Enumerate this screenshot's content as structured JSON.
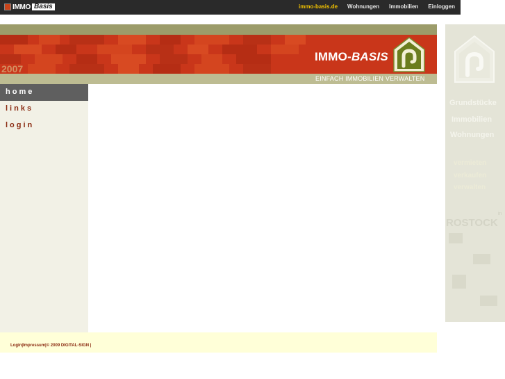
{
  "topbar": {
    "logo_text1": "IMMO",
    "logo_text2": "Basis",
    "nav": [
      {
        "label": "immo-basis.de",
        "active": true
      },
      {
        "label": "Wohnungen",
        "active": false
      },
      {
        "label": "Immobilien",
        "active": false
      },
      {
        "label": "Einloggen",
        "active": false
      }
    ]
  },
  "banner": {
    "year": "2007",
    "brand_part1": "IMMO-",
    "brand_part2": "BASIS",
    "tagline": "EINFACH IMMOBILIEN VERWALTEN"
  },
  "leftnav": {
    "items": [
      {
        "label": "home",
        "active": true
      },
      {
        "label": "links",
        "active": false
      },
      {
        "label": "login",
        "active": false
      }
    ]
  },
  "footer": {
    "login": "Login",
    "impressum": "Impressum",
    "copyright": "© 2009 DIGITAL-SIGN"
  },
  "sidepanel": {
    "words": [
      "Grundstücke",
      "Immobilien",
      "Wohnungen"
    ],
    "actions": [
      "vermieten",
      "verkaufen",
      "verwalten"
    ],
    "in": "in",
    "city": "ROSTOCK"
  },
  "colors": {
    "topbar_bg": "#2a2a2a",
    "active_nav": "#f2c200",
    "banner_red": "#c9361a",
    "accent_text": "#8a2a10",
    "olive": "#9c9c6a"
  }
}
